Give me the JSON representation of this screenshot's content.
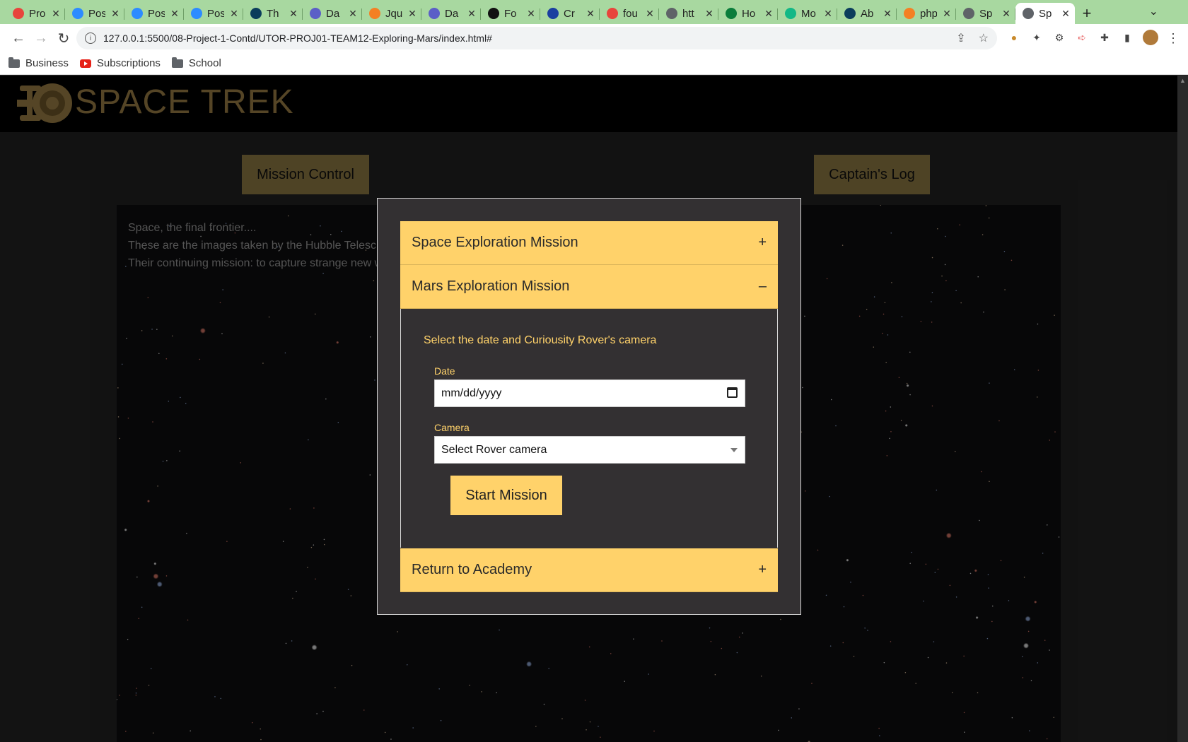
{
  "browser": {
    "tabs": [
      {
        "title": "Pro",
        "icon": "red-ring-icon",
        "color": "#e8453c"
      },
      {
        "title": "Pos",
        "icon": "zoom-icon",
        "color": "#2d8cff"
      },
      {
        "title": "Pos",
        "icon": "zoom-icon",
        "color": "#2d8cff"
      },
      {
        "title": "Pos",
        "icon": "zoom-icon",
        "color": "#2d8cff"
      },
      {
        "title": "Th",
        "icon": "f-icon",
        "color": "#0b3d5c"
      },
      {
        "title": "Da",
        "icon": "globe-icon",
        "color": "#5b5fc7"
      },
      {
        "title": "Jqu",
        "icon": "stack-icon",
        "color": "#f48024"
      },
      {
        "title": "Da",
        "icon": "globe-icon",
        "color": "#5b5fc7"
      },
      {
        "title": "Fo",
        "icon": "codepen-icon",
        "color": "#111111"
      },
      {
        "title": "Cr",
        "icon": "cloud-icon",
        "color": "#1a3fa0"
      },
      {
        "title": "fou",
        "icon": "shield-icon",
        "color": "#e8453c"
      },
      {
        "title": "htt",
        "icon": "globe-icon",
        "color": "#5f6368"
      },
      {
        "title": "Ho",
        "icon": "w-icon",
        "color": "#0a7d3b"
      },
      {
        "title": "Mo",
        "icon": "leaf-icon",
        "color": "#12b886"
      },
      {
        "title": "Ab",
        "icon": "f-icon",
        "color": "#0b3d5c"
      },
      {
        "title": "php",
        "icon": "stack-icon",
        "color": "#f48024"
      },
      {
        "title": "Sp",
        "icon": "globe-icon",
        "color": "#5f6368"
      },
      {
        "title": "Sp",
        "icon": "globe-icon",
        "color": "#5f6368",
        "active": true
      }
    ],
    "new_tab": "+",
    "url": "127.0.0.1:5500/08-Project-1-Contd/UTOR-PROJ01-TEAM12-Exploring-Mars/index.html#",
    "bookmarks": [
      "Business",
      "Subscriptions",
      "School"
    ]
  },
  "site": {
    "brand": "SPACE TREK",
    "nav": {
      "mission_control": "Mission Control",
      "captains_log": "Captain's Log"
    },
    "intro_lines": [
      "Space, the final frontier....",
      "These are the images taken by the Hubble Telesc",
      "Their continuing mission: to capture strange new w"
    ]
  },
  "modal": {
    "sections": {
      "space": {
        "title": "Space Exploration Mission",
        "sign": "+"
      },
      "mars": {
        "title": "Mars Exploration Mission",
        "sign": "–"
      },
      "academy": {
        "title": "Return to Academy",
        "sign": "+"
      }
    },
    "mars_form": {
      "prompt": "Select the date and Curiousity Rover's camera",
      "date_label": "Date",
      "date_placeholder": "mm/dd/yyyy",
      "camera_label": "Camera",
      "camera_selected": "Select Rover camera",
      "submit": "Start Mission"
    }
  },
  "colors": {
    "accent": "#ffd26a",
    "brand": "#9c7f45",
    "nav_button": "#8f7a44"
  }
}
